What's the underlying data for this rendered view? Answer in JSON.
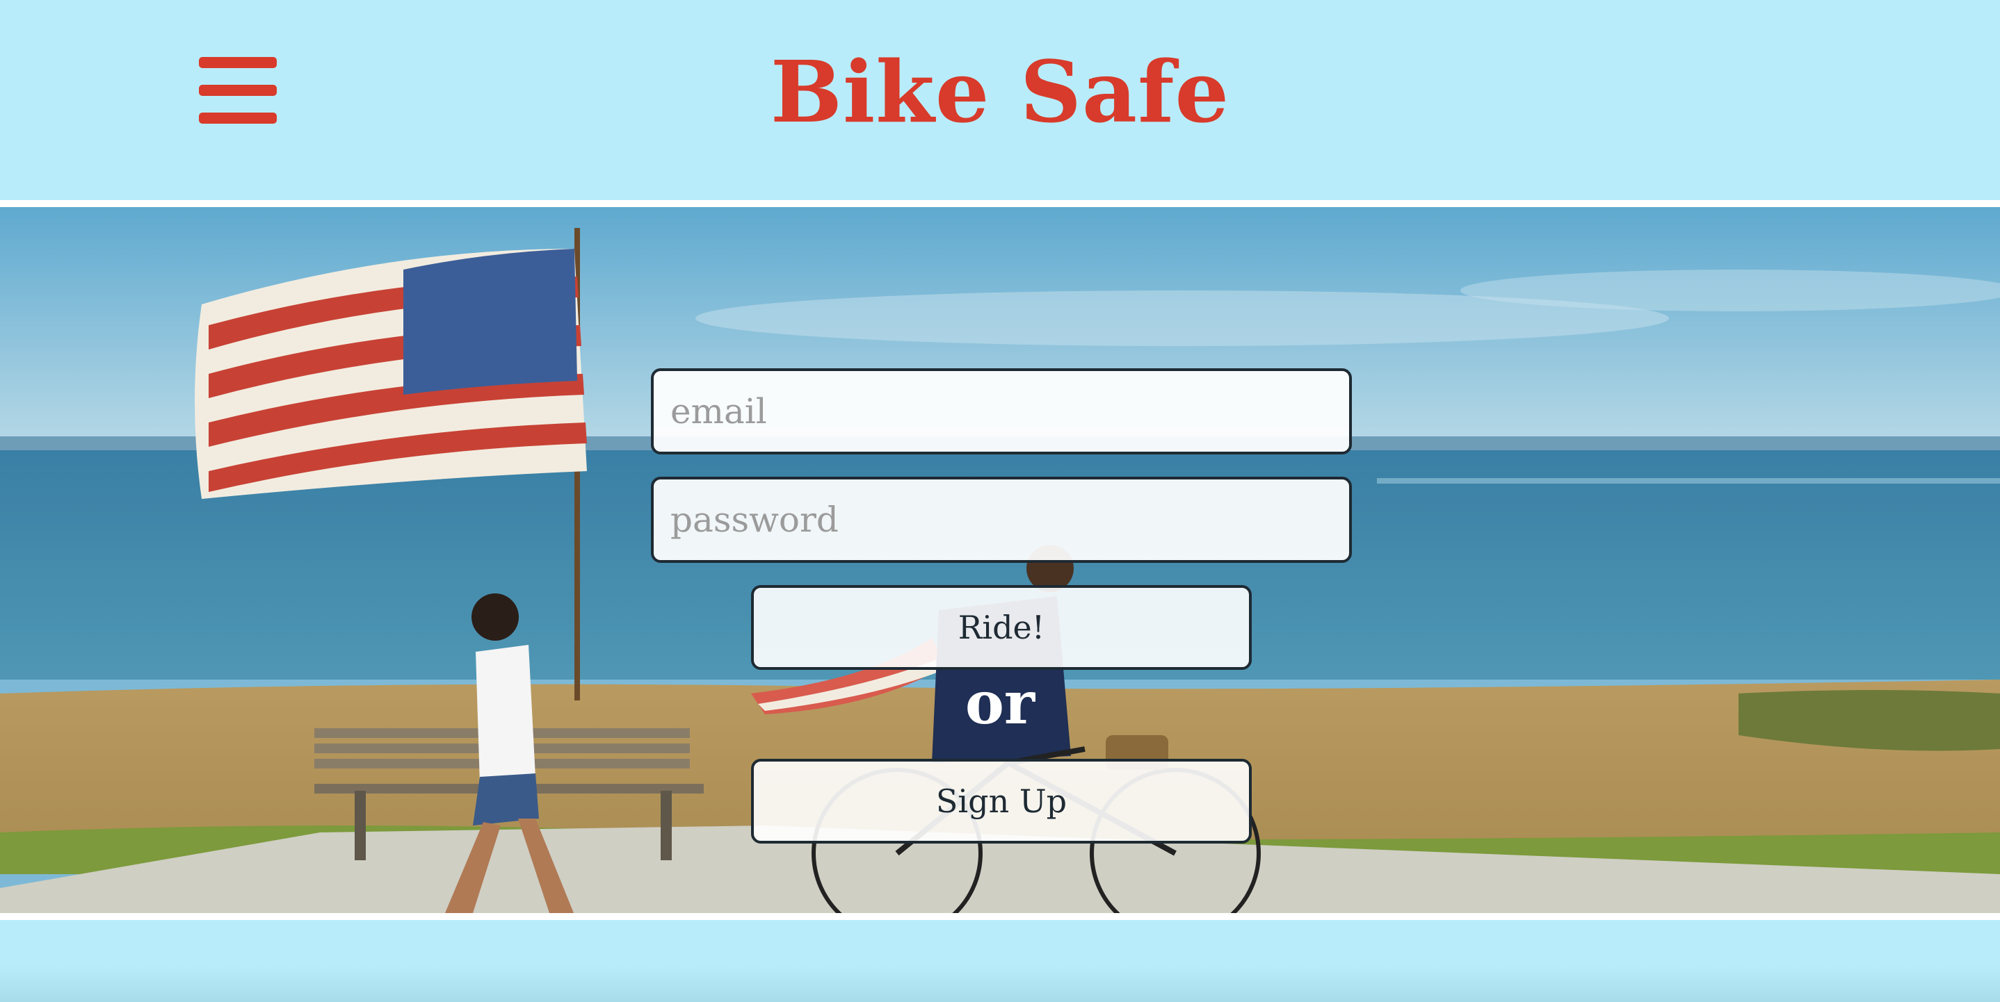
{
  "header": {
    "title": "Bike Safe",
    "menu_icon": "hamburger-menu-icon"
  },
  "hero": {
    "image_description_icon": "beach-flag-bicycle-photo"
  },
  "login": {
    "email_placeholder": "email",
    "password_placeholder": "password",
    "ride_label": "Ride!",
    "or_label": "or",
    "signup_label": "Sign Up"
  },
  "colors": {
    "background": "#b9ecfa",
    "brand_red": "#d83b2b",
    "border_dark": "#1e2a33"
  }
}
